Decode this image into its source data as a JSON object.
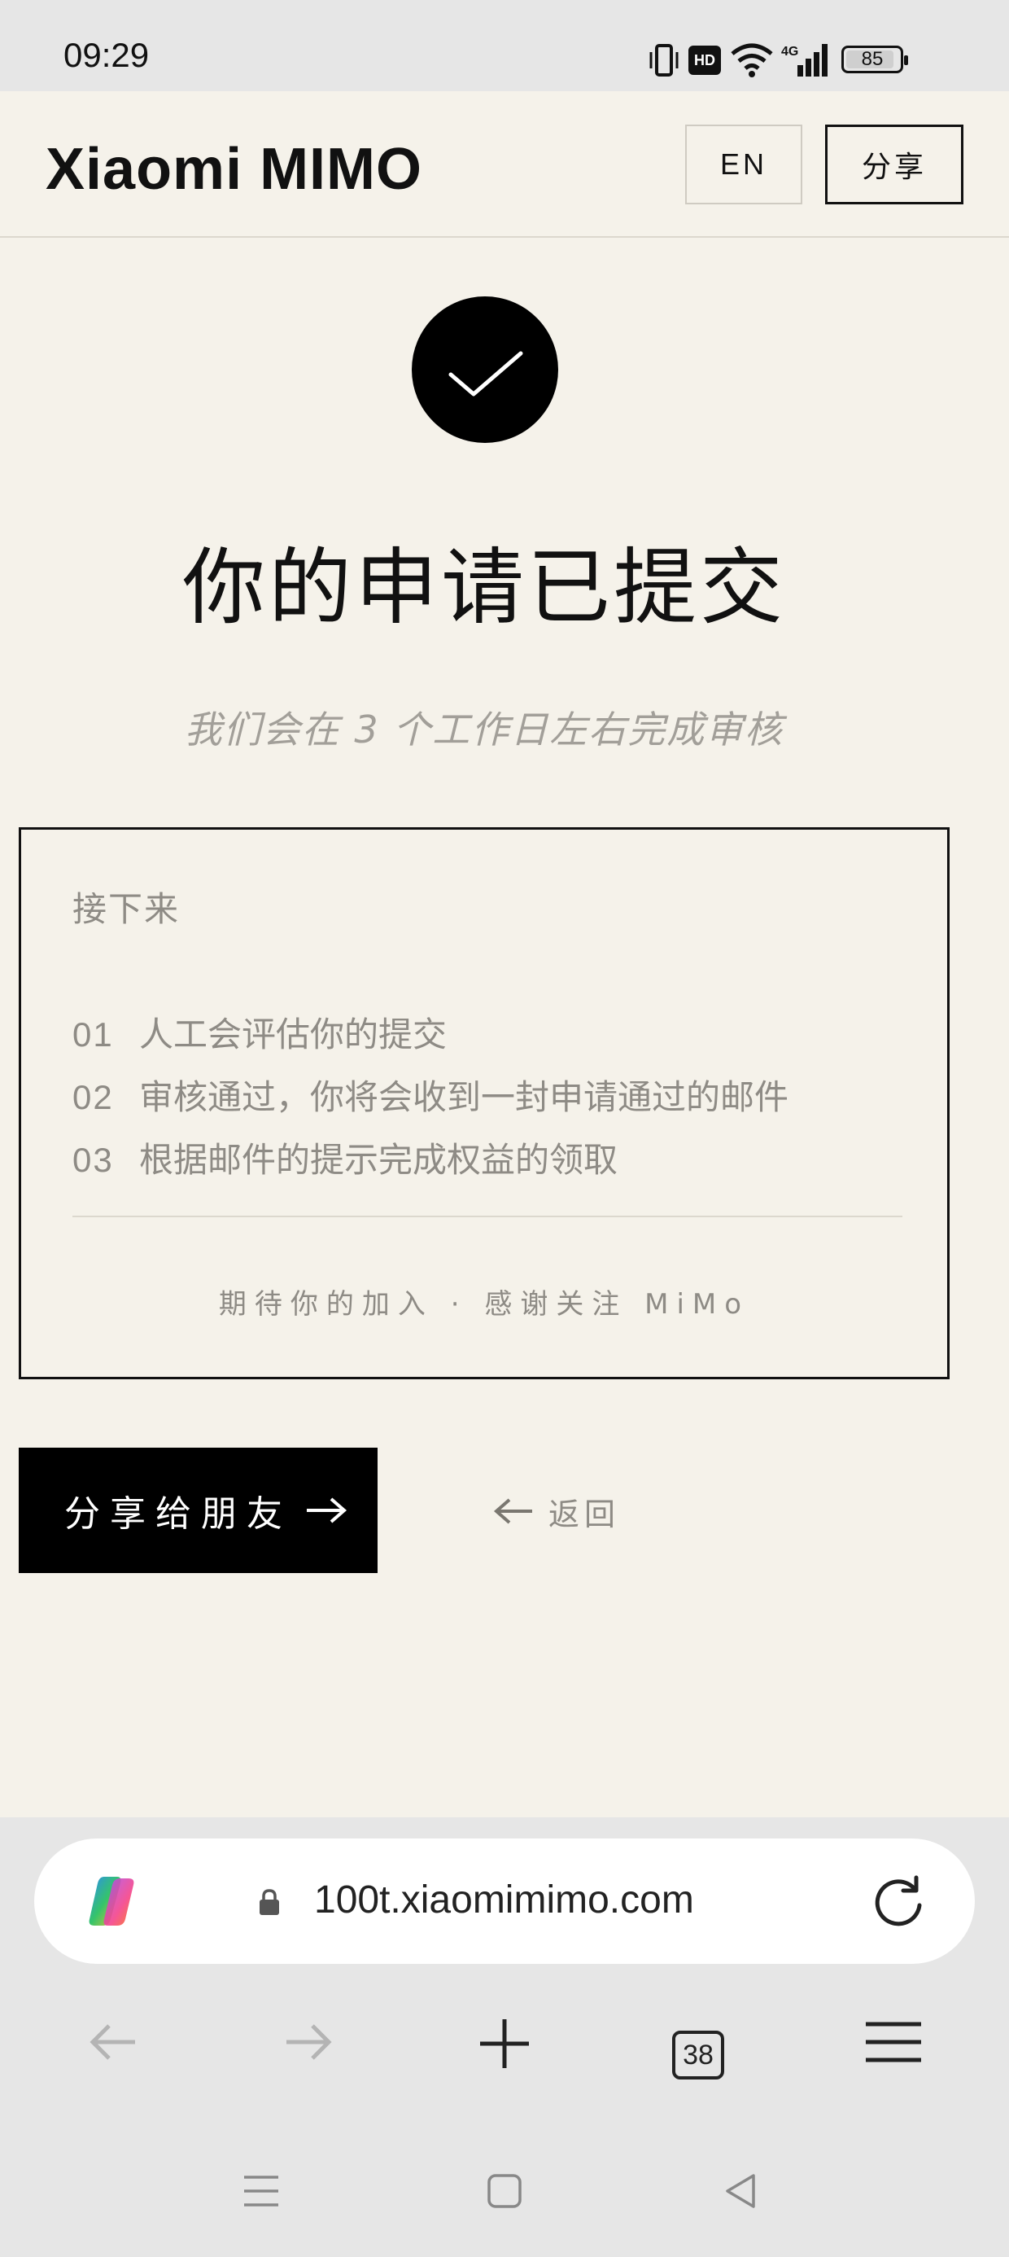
{
  "status_bar": {
    "time": "09:29",
    "network": "4G",
    "hd": "HD",
    "battery": "85",
    "icons": [
      "vibrate-icon",
      "hd-icon",
      "wifi-icon",
      "signal-4g-icon",
      "battery-icon"
    ]
  },
  "header": {
    "logo": "Xiaomi MIMO",
    "lang_button": "EN",
    "share_button": "分享"
  },
  "main": {
    "title": "你的申请已提交",
    "subtitle": "我们会在 3 个工作日左右完成审核",
    "next": {
      "heading": "接下来",
      "steps": [
        {
          "num": "01",
          "text": "人工会评估你的提交"
        },
        {
          "num": "02",
          "text": "审核通过，你将会收到一封申请通过的邮件"
        },
        {
          "num": "03",
          "text": "根据邮件的提示完成权益的领取"
        }
      ],
      "footer": "期待你的加入 · 感谢关注 MiMo"
    },
    "share_friend_button": "分享给朋友",
    "back_button": "返回"
  },
  "browser": {
    "url": "100t.xiaomimimo.com",
    "tab_count": "38"
  },
  "colors": {
    "page_bg": "#f5f2ea",
    "ink": "#111111",
    "muted": "#8e8b85",
    "chrome": "#e6e6e6"
  }
}
